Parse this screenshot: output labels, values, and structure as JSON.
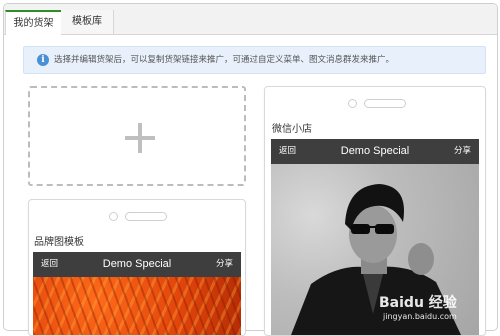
{
  "tabs": [
    {
      "label": "我的货架"
    },
    {
      "label": "模板库"
    }
  ],
  "notice": {
    "text": "选择并编辑货架后，可以复制货架链接来推广，可通过自定义菜单、图文消息群发来推广。"
  },
  "cards": [
    {
      "title": "品牌图模板",
      "phone": {
        "back": "返回",
        "title": "Demo Special",
        "share": "分享"
      }
    },
    {
      "title": "微信小店",
      "phone": {
        "back": "返回",
        "title": "Demo Special",
        "share": "分享"
      }
    }
  ],
  "watermark": {
    "brand": "Baidu 经验",
    "url": "jingyan.baidu.com"
  },
  "colors": {
    "accent_green": "#2e8f2a",
    "notice_bg": "#e8f1fb",
    "info_blue": "#4a90d6",
    "phone_bar": "#3e3e3e"
  }
}
